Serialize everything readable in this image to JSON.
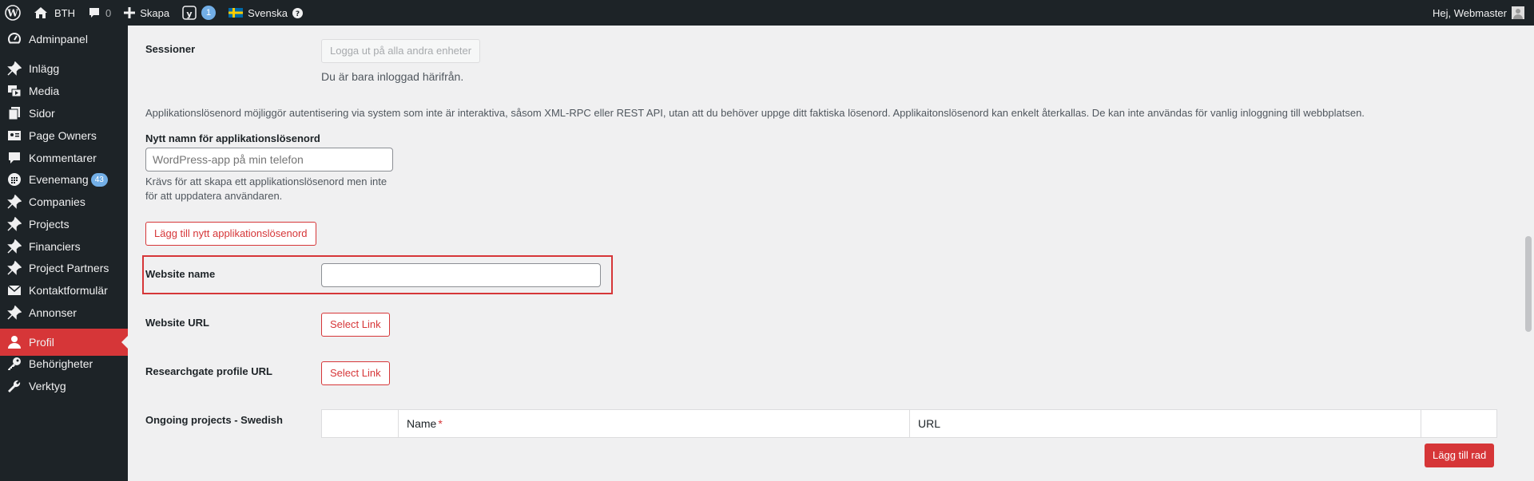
{
  "adminbar": {
    "site_name": "BTH",
    "comments_count": "0",
    "new_label": "Skapa",
    "yoast_count": "1",
    "language_label": "Svenska",
    "greeting": "Hej, Webmaster"
  },
  "menu": {
    "items": [
      {
        "label": "Adminpanel",
        "icon": "dashboard-icon"
      },
      {
        "label": "Inlägg",
        "icon": "pin-icon"
      },
      {
        "label": "Media",
        "icon": "media-icon"
      },
      {
        "label": "Sidor",
        "icon": "pages-icon"
      },
      {
        "label": "Page Owners",
        "icon": "page-owners-icon"
      },
      {
        "label": "Kommentarer",
        "icon": "comment-icon"
      },
      {
        "label": "Evenemang",
        "icon": "calendar-icon",
        "badge": "43"
      },
      {
        "label": "Companies",
        "icon": "pin-icon"
      },
      {
        "label": "Projects",
        "icon": "pin-icon"
      },
      {
        "label": "Financiers",
        "icon": "pin-icon"
      },
      {
        "label": "Project Partners",
        "icon": "pin-icon"
      },
      {
        "label": "Kontaktformulär",
        "icon": "mail-icon"
      },
      {
        "label": "Annonser",
        "icon": "pin-icon"
      },
      {
        "label": "Profil",
        "icon": "user-icon",
        "current": true
      },
      {
        "label": "Behörigheter",
        "icon": "key-icon"
      },
      {
        "label": "Verktyg",
        "icon": "wrench-icon"
      }
    ]
  },
  "sessions": {
    "label": "Sessioner",
    "button": "Logga ut på alla andra enheter",
    "description": "Du är bara inloggad härifrån."
  },
  "app_passwords": {
    "intro": "Applikationslösenord möjliggör autentisering via system som inte är interaktiva, såsom XML-RPC eller REST API, utan att du behöver uppge ditt faktiska lösenord. Applikaitonslösenord kan enkelt återkallas. De kan inte användas för vanlig inloggning till webbplatsen.",
    "name_label": "Nytt namn för applikationslösenord",
    "name_placeholder": "WordPress-app på min telefon",
    "help_line1": "Krävs för att skapa ett applikationslösenord men inte",
    "help_line2": "för att uppdatera användaren.",
    "add_button": "Lägg till nytt applikationslösenord"
  },
  "fields": {
    "website_name_label": "Website name",
    "website_name_value": "",
    "website_url_label": "Website URL",
    "website_url_button": "Select Link",
    "researchgate_label": "Researchgate profile URL",
    "researchgate_button": "Select Link",
    "ongoing_label": "Ongoing projects - Swedish",
    "table_col_name": "Name",
    "table_col_required": "*",
    "table_col_url": "URL",
    "add_row_button": "Lägg till rad"
  },
  "colors": {
    "adminbar_bg": "#1d2327",
    "accent_red": "#d63638",
    "badge_blue": "#72aee6"
  }
}
